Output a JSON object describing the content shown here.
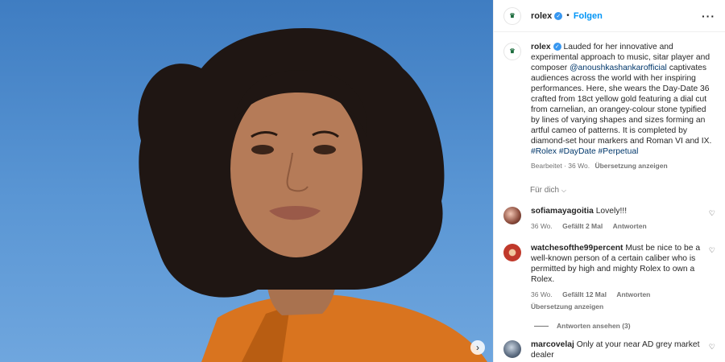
{
  "header": {
    "username": "rolex",
    "separator": "•",
    "follow_label": "Folgen",
    "more_icon": "more-horizontal-icon",
    "logo_text": "♛"
  },
  "caption": {
    "username": "rolex",
    "text_1": "Lauded for her innovative and experimental approach to music, sitar player and composer ",
    "mention": "@anoushkashankarofficial",
    "text_2": " captivates audiences across the world with her inspiring performances. Here, she wears the Day-Date 36 crafted from 18ct yellow gold featuring a dial cut from carnelian, an orangey-colour stone typified by lines of varying shapes and sizes forming an artful cameo of patterns. It is completed by diamond-set hour markers and Roman VI and IX.",
    "hashtags": "#Rolex #DayDate #Perpetual",
    "edited": "Bearbeitet · 36 Wo.",
    "translate": "Übersetzung anzeigen"
  },
  "fuer_dich": "Für dich",
  "comments": [
    {
      "username": "sofiamayagoitia",
      "text": "Lovely!!!",
      "time": "36 Wo.",
      "likes": "Gefällt 2 Mal",
      "reply": "Antworten"
    },
    {
      "username": "watchesofthe99percent",
      "text": "Must be nice to be a well-known person of a certain caliber who is permitted by high and mighty Rolex to own a Rolex.",
      "time": "36 Wo.",
      "likes": "Gefällt 12 Mal",
      "reply": "Antworten",
      "translate": "Übersetzung anzeigen",
      "view_replies": "Antworten ansehen (3)"
    },
    {
      "username": "marcovelaj",
      "text": "Only at your near AD grey market dealer"
    }
  ],
  "colors": {
    "sky": "#5a96d4",
    "blouse": "#d9741f",
    "link": "#00376b",
    "follow": "#0095f6"
  }
}
